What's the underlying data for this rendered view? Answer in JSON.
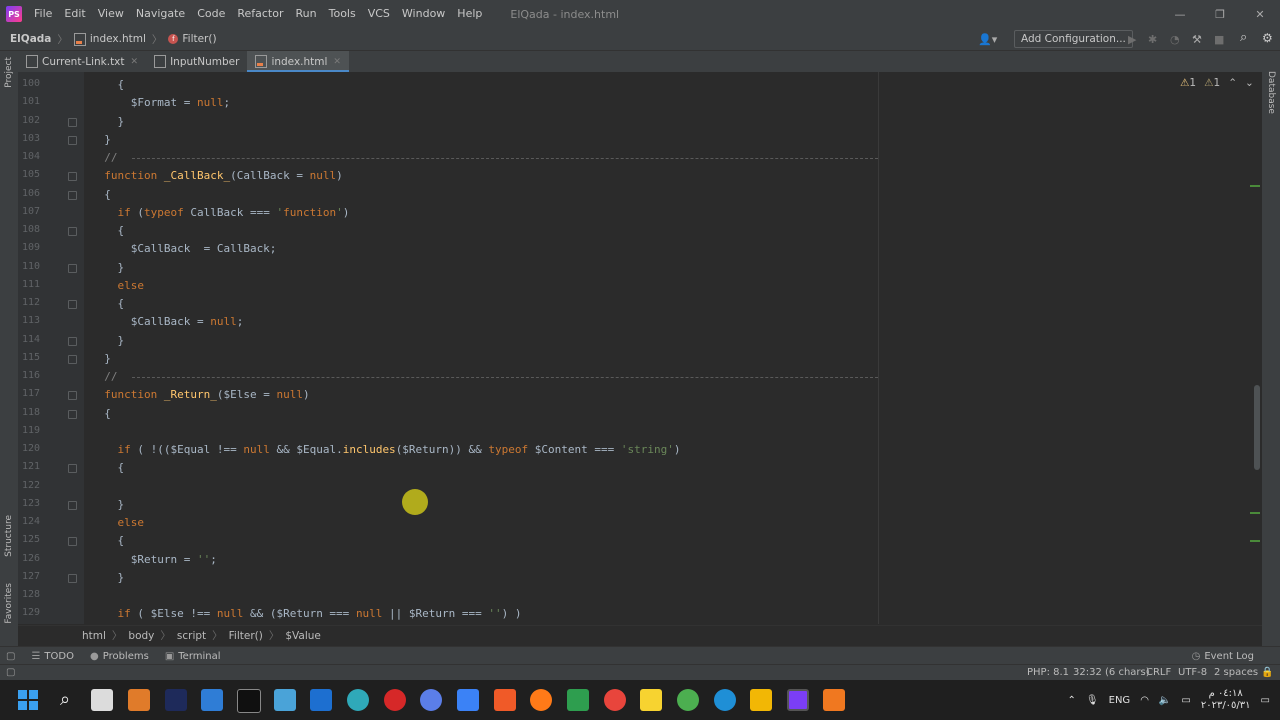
{
  "window": {
    "menu": [
      "File",
      "Edit",
      "View",
      "Navigate",
      "Code",
      "Refactor",
      "Run",
      "Tools",
      "VCS",
      "Window",
      "Help"
    ],
    "title": "ElQada - index.html",
    "controls": [
      "—",
      "❐",
      "✕"
    ]
  },
  "nav": {
    "project": "ElQada",
    "file": "index.html",
    "function": "Filter()",
    "add_configuration": "Add Configuration..."
  },
  "tabs": [
    {
      "label": "Current-Link.txt",
      "active": false
    },
    {
      "label": "InputNumber",
      "active": false
    },
    {
      "label": "index.html",
      "active": true
    }
  ],
  "side_panels": {
    "left": [
      "Project",
      "Structure",
      "Favorites"
    ],
    "right": [
      "Database"
    ]
  },
  "editor": {
    "lines": [
      {
        "n": "100",
        "code": "    {"
      },
      {
        "n": "101",
        "code": "      $Format = null;"
      },
      {
        "n": "102",
        "code": "    }"
      },
      {
        "n": "103",
        "code": "  }"
      },
      {
        "n": "104",
        "code": "  //"
      },
      {
        "n": "105",
        "code": "  function _CallBack_(CallBack = null)"
      },
      {
        "n": "106",
        "code": "  {"
      },
      {
        "n": "107",
        "code": "    if (typeof CallBack === 'function')"
      },
      {
        "n": "108",
        "code": "    {"
      },
      {
        "n": "109",
        "code": "      $CallBack  = CallBack;"
      },
      {
        "n": "110",
        "code": "    }"
      },
      {
        "n": "111",
        "code": "    else"
      },
      {
        "n": "112",
        "code": "    {"
      },
      {
        "n": "113",
        "code": "      $CallBack = null;"
      },
      {
        "n": "114",
        "code": "    }"
      },
      {
        "n": "115",
        "code": "  }"
      },
      {
        "n": "116",
        "code": "  //"
      },
      {
        "n": "117",
        "code": "  function _Return_($Else = null)"
      },
      {
        "n": "118",
        "code": "  {"
      },
      {
        "n": "119",
        "code": ""
      },
      {
        "n": "120",
        "code": "    if ( !(($Equal !== null && $Equal.includes($Return)) && typeof $Content === 'string')"
      },
      {
        "n": "121",
        "code": "    {"
      },
      {
        "n": "122",
        "code": ""
      },
      {
        "n": "123",
        "code": "    }"
      },
      {
        "n": "124",
        "code": "    else"
      },
      {
        "n": "125",
        "code": "    {"
      },
      {
        "n": "126",
        "code": "      $Return = '';"
      },
      {
        "n": "127",
        "code": "    }"
      },
      {
        "n": "128",
        "code": ""
      },
      {
        "n": "129",
        "code": "    if ( $Else !== null && ($Return === null || $Return === '') )"
      }
    ],
    "warnings": {
      "warn_count": "1",
      "weak_count": "1"
    }
  },
  "breadcrumbs": [
    "html",
    "body",
    "script",
    "Filter()",
    "$Value"
  ],
  "tool_windows": {
    "todo": "TODO",
    "problems": "Problems",
    "terminal": "Terminal",
    "event_log": "Event Log"
  },
  "status": {
    "php": "PHP: 8.1",
    "position": "32:32 (6 chars)",
    "line_sep": "CRLF",
    "encoding": "UTF-8",
    "indent": "2 spaces"
  },
  "taskbar": {
    "lang": "ENG",
    "time": "٠٤:١٨ م",
    "date": "٢٠٢٣/٠٥/٣١"
  }
}
